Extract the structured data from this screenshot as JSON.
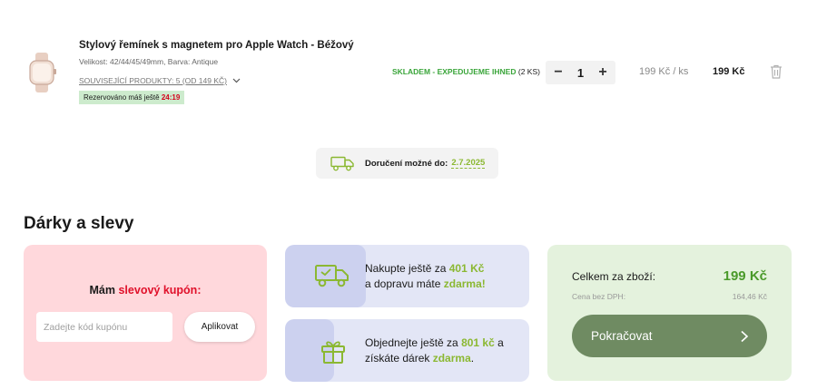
{
  "product": {
    "name": "Stylový řemínek s magnetem pro Apple Watch - Béžový",
    "variant": "Velikost: 42/44/45/49mm, Barva: Antique",
    "related": "SOUVISEJÍCÍ PRODUKTY: 5 (OD 149 KČ)",
    "reserved_label": "Rezervováno máš ještě",
    "reserved_timer": "24:19",
    "stock_status": "SKLADEM - EXPEDUJEME IHNED",
    "stock_count": "(2 KS)",
    "quantity": "1",
    "qty_minus": "−",
    "qty_plus": "+",
    "unit_price": "199 Kč",
    "unit_suffix": "/ ks",
    "total_price": "199 Kč",
    "thumb_icon": "watch-strap-image",
    "delete_icon": "trash-icon"
  },
  "delivery": {
    "label": "Doručení možné do:",
    "date": "2.7.2025",
    "icon": "truck-icon"
  },
  "section": {
    "title": "Dárky a slevy"
  },
  "coupon": {
    "title_prefix": "Mám",
    "title_highlight": "slevový kupón:",
    "input_placeholder": "Zadejte kód kupónu",
    "apply_label": "Aplikovat"
  },
  "shipping_info": {
    "part1": "Nakupte ještě za",
    "amount": "401 Kč",
    "part2": "a dopravu máte",
    "free": "zdarma!",
    "icon": "truck-icon"
  },
  "gift_info": {
    "part1": "Objednejte ještě za",
    "amount": "801 kč",
    "part2": "a získáte dárek",
    "gift": "zdarma",
    "end": ".",
    "icon": "gift-icon"
  },
  "summary": {
    "total_label": "Celkem za zboží:",
    "total_value": "199 Kč",
    "net_label": "Cena bez DPH:",
    "net_value": "164,46 Kč",
    "continue_label": "Pokračovat"
  },
  "colors": {
    "accent_green": "#8bb832",
    "stock_green": "#3aa53a",
    "coupon_red": "#e0102a",
    "button_olive": "#6f8b62"
  }
}
